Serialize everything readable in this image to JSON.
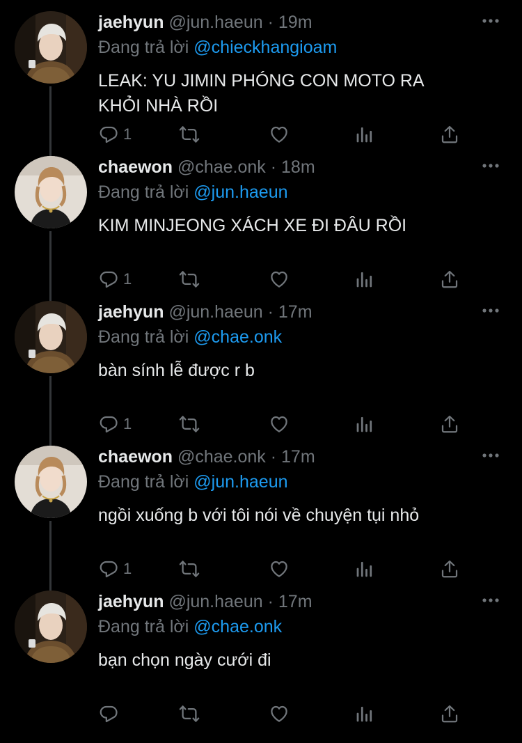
{
  "tweets": [
    {
      "name": "jaehyun",
      "handle": "@jun.haeun",
      "sep": "·",
      "time": "19m",
      "reply_prefix": "Đang trả lời",
      "reply_to": "@chieckhangioam",
      "text_lines": [
        "LEAK: YU JIMIN PHÓNG CON MOTO RA",
        "KHỎI NHÀ RỒI"
      ],
      "reply_count": "1",
      "avatar": "jaehyun-avatar"
    },
    {
      "name": "chaewon",
      "handle": "@chae.onk",
      "sep": "·",
      "time": "18m",
      "reply_prefix": "Đang trả lời",
      "reply_to": "@jun.haeun",
      "text_lines": [
        "KIM MINJEONG XÁCH XE ĐI ĐÂU RỒI"
      ],
      "reply_count": "1",
      "avatar": "chaewon-avatar"
    },
    {
      "name": "jaehyun",
      "handle": "@jun.haeun",
      "sep": "·",
      "time": "17m",
      "reply_prefix": "Đang trả lời",
      "reply_to": "@chae.onk",
      "text_lines": [
        "bàn sính lễ được r b"
      ],
      "reply_count": "1",
      "avatar": "jaehyun-avatar"
    },
    {
      "name": "chaewon",
      "handle": "@chae.onk",
      "sep": "·",
      "time": "17m",
      "reply_prefix": "Đang trả lời",
      "reply_to": "@jun.haeun",
      "text_lines": [
        "ngồi xuống b với tôi nói về chuyện tụi nhỏ"
      ],
      "reply_count": "1",
      "avatar": "chaewon-avatar"
    },
    {
      "name": "jaehyun",
      "handle": "@jun.haeun",
      "sep": "·",
      "time": "17m",
      "reply_prefix": "Đang trả lời",
      "reply_to": "@chae.onk",
      "text_lines": [
        "bạn chọn ngày cưới đi"
      ],
      "reply_count": "",
      "avatar": "jaehyun-avatar"
    }
  ],
  "icons": {
    "reply": "reply-icon",
    "retweet": "retweet-icon",
    "like": "heart-icon",
    "views": "views-chart-icon",
    "share": "share-icon",
    "more": "more-dots-icon"
  },
  "colors": {
    "background": "#000000",
    "text": "#e7e9ea",
    "muted": "#71767b",
    "mention": "#1d9bf0",
    "thread_line": "#333639"
  }
}
